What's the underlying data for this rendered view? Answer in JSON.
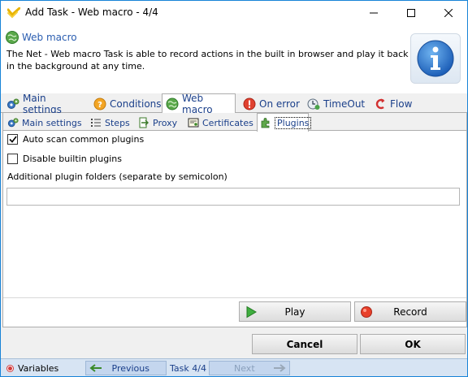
{
  "window": {
    "title": "Add Task - Web macro - 4/4"
  },
  "header": {
    "title": "Web macro",
    "description": "The Net - Web macro Task is able to record actions in the built in browser and play it back in the background at any time.",
    "info_icon": "info-icon"
  },
  "main_tabs": [
    {
      "label": "Main settings",
      "icon": "gears-icon",
      "active": false
    },
    {
      "label": "Conditions",
      "icon": "question-icon",
      "active": false
    },
    {
      "label": "Web macro",
      "icon": "globe-icon",
      "active": true
    },
    {
      "label": "On error",
      "icon": "error-icon",
      "active": false
    },
    {
      "label": "TimeOut",
      "icon": "timeout-icon",
      "active": false
    },
    {
      "label": "Flow",
      "icon": "flow-icon",
      "active": false
    }
  ],
  "sub_tabs": [
    {
      "label": "Main settings",
      "icon": "gears-icon",
      "active": false
    },
    {
      "label": "Steps",
      "icon": "list-icon",
      "active": false
    },
    {
      "label": "Proxy",
      "icon": "proxy-icon",
      "active": false
    },
    {
      "label": "Certificates",
      "icon": "certificate-icon",
      "active": false
    },
    {
      "label": "Plugins",
      "icon": "plugin-icon",
      "active": true
    }
  ],
  "plugins": {
    "auto_scan_label": "Auto scan common plugins",
    "auto_scan_checked": true,
    "disable_builtin_label": "Disable builtin plugins",
    "disable_builtin_checked": false,
    "folders_label": "Additional plugin folders (separate by semicolon)",
    "folders_value": ""
  },
  "actions": {
    "play_label": "Play",
    "record_label": "Record"
  },
  "dialog": {
    "cancel_label": "Cancel",
    "ok_label": "OK"
  },
  "navbar": {
    "variables_label": "Variables",
    "previous_label": "Previous",
    "task_label": "Task 4/4",
    "next_label": "Next"
  },
  "colors": {
    "accent": "#1883d7",
    "tab_text": "#1a3f8a",
    "header_title": "#2a5db0",
    "navbar_bg": "#d7e4f3"
  }
}
